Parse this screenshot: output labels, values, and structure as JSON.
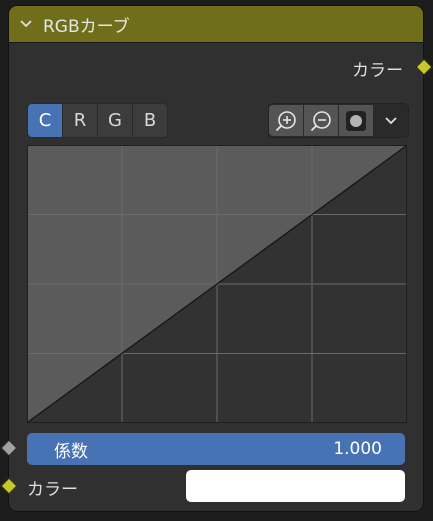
{
  "node": {
    "title": "RGBカーブ",
    "output_label": "カラー",
    "tabs": [
      "C",
      "R",
      "G",
      "B"
    ],
    "active_tab": "C",
    "tools": [
      "zoom-in-icon",
      "zoom-out-icon",
      "clipping-icon",
      "chevron-down-icon"
    ],
    "factor": {
      "label": "係数",
      "value": "1.000"
    },
    "color_input": {
      "label": "カラー",
      "value": "#ffffff"
    },
    "colors": {
      "header": "#6e6e1b",
      "accent": "#4772b3",
      "socket_color": "#c7c729",
      "socket_float": "#a1a1a1"
    }
  }
}
